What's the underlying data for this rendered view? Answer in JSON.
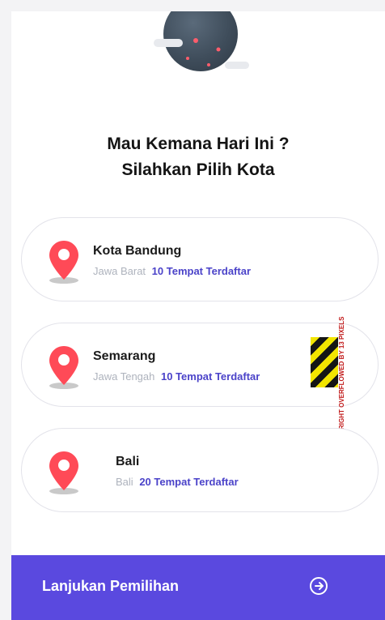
{
  "header": {
    "title_line1": "Mau Kemana Hari Ini ?",
    "title_line2": "Silahkan Pilih Kota"
  },
  "cities": [
    {
      "name": "Kota Bandung",
      "region": "Jawa Barat",
      "count": "10 Tempat Terdaftar"
    },
    {
      "name": "Semarang",
      "region": "Jawa Tengah",
      "count": "10 Tempat Terdaftar"
    },
    {
      "name": "Bali",
      "region": "Bali",
      "count": "20 Tempat Terdaftar"
    }
  ],
  "overlay": {
    "warning_text": "RIGHT OVERFLOWED BY 13 PIXELS"
  },
  "footer": {
    "button_label": "Lanjukan Pemilihan"
  },
  "colors": {
    "accent": "#5a49df",
    "pin": "#ff4a57",
    "count_text": "#4b43c9"
  }
}
